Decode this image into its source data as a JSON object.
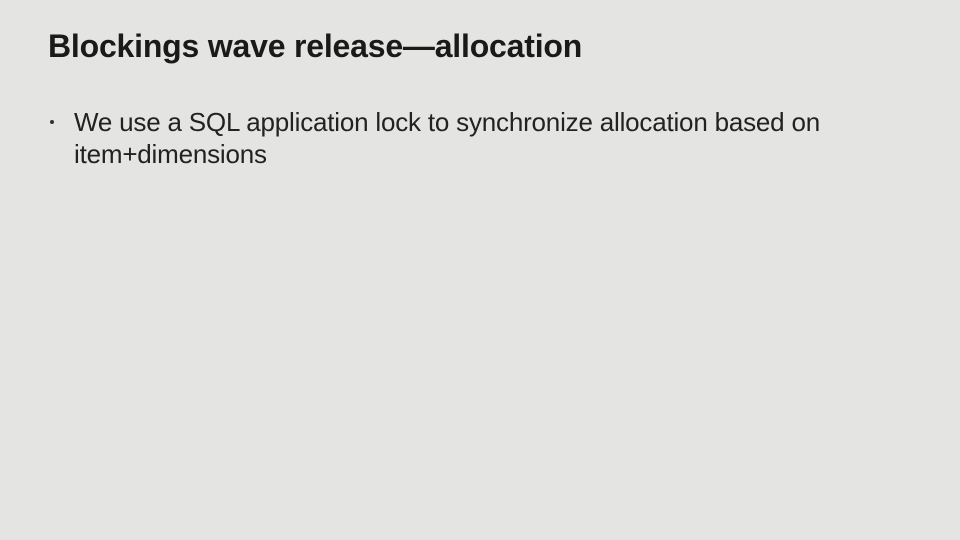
{
  "slide": {
    "title": "Blockings wave release—allocation",
    "bullets": [
      {
        "text": "We use a SQL application lock to synchronize allocation based on item+dimensions"
      }
    ]
  }
}
